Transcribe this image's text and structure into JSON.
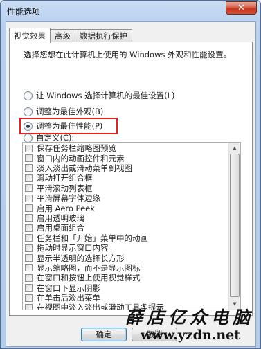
{
  "window": {
    "title": "性能选项",
    "close_glyph": "✕"
  },
  "tabs": [
    {
      "label": "视觉效果",
      "active": true
    },
    {
      "label": "高级",
      "active": false
    },
    {
      "label": "数据执行保护",
      "active": false
    }
  ],
  "visual_effects": {
    "description": "选择您想在此计算机上使用的 Windows 外观和性能设置。",
    "options": [
      {
        "label": "让 Windows 选择计算机的最佳设置(L)",
        "checked": false
      },
      {
        "label": "调整为最佳外观(B)",
        "checked": false
      },
      {
        "label": "调整为最佳性能(P)",
        "checked": true
      },
      {
        "label": "自定义(C):",
        "checked": false
      }
    ],
    "effects": [
      "保存任务栏缩略图预览",
      "窗口内的动画控件和元素",
      "淡入淡出或滑动菜单到视图",
      "滑动打开组合框",
      "平滑滚动列表框",
      "平滑屏幕字体边缘",
      "启用 Aero Peek",
      "启用透明玻璃",
      "启用桌面组合",
      "任务栏和「开始」菜单中的动画",
      "拖动时显示窗口内容",
      "显示半透明的选择长方形",
      "显示缩略图，而不是显示图标",
      "在窗口和按钮上使用视觉样式",
      "在窗口下显示阴影",
      "在单击后淡出菜单",
      "在视图中淡入淡出或滑动工具条提示",
      "在鼠标指针下显示阴影",
      "在桌面上为图标标签使用阴影"
    ]
  },
  "buttons": {
    "ok": "确定",
    "cancel": "取消"
  },
  "watermark": {
    "title": "薛店亿众电脑",
    "url": "www.yzdn.net"
  },
  "colors": {
    "highlight_box": "#e8201f",
    "close_button": "#c5371f"
  }
}
